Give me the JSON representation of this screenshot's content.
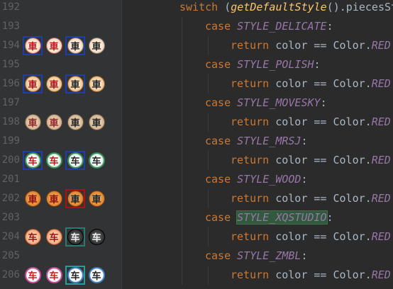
{
  "editor": {
    "switch_line": {
      "keyword": "switch",
      "open": " (",
      "fn": "getDefaultStyle",
      "rest": "().piecesSt"
    },
    "case_keyword": "case",
    "return_text": "return",
    "return_body": " color == Color.",
    "red": "RED",
    "colon": ":",
    "cases": [
      "STYLE_DELICATE",
      "STYLE_POLISH",
      "STYLE_MOVESKY",
      "STYLE_MRSJ",
      "STYLE_WOOD",
      "STYLE_XQSTUDIO",
      "STYLE_ZMBL"
    ],
    "line_numbers": [
      "192",
      "193",
      "194",
      "195",
      "196",
      "197",
      "198",
      "199",
      "200",
      "201",
      "202",
      "203",
      "204",
      "205",
      "206"
    ]
  },
  "gutter_icons": {
    "row_194": {
      "chars": [
        "車",
        "車",
        "車",
        "車"
      ],
      "style": "delicate"
    },
    "row_196": {
      "chars": [
        "車",
        "車",
        "車",
        "車"
      ],
      "style": "polish"
    },
    "row_198": {
      "chars": [
        "車",
        "車",
        "車",
        "車"
      ],
      "style": "movesky"
    },
    "row_200": {
      "chars": [
        "车",
        "车",
        "车",
        "车"
      ],
      "style": "mrsj"
    },
    "row_202": {
      "chars": [
        "車",
        "車",
        "車",
        "車"
      ],
      "style": "wood"
    },
    "row_204": {
      "chars": [
        "车",
        "车",
        "车",
        "车"
      ],
      "style": "xqstudio"
    },
    "row_206": {
      "chars": [
        "车",
        "车",
        "车",
        "车"
      ],
      "style": "zmbl"
    }
  },
  "colors": {
    "background": "#2b2b2b",
    "gutter": "#313335",
    "keyword": "#cc7832",
    "constant": "#9876aa",
    "function": "#ffc66d",
    "text": "#a9b7c6",
    "line_number": "#606366",
    "highlight": "#32593d"
  }
}
